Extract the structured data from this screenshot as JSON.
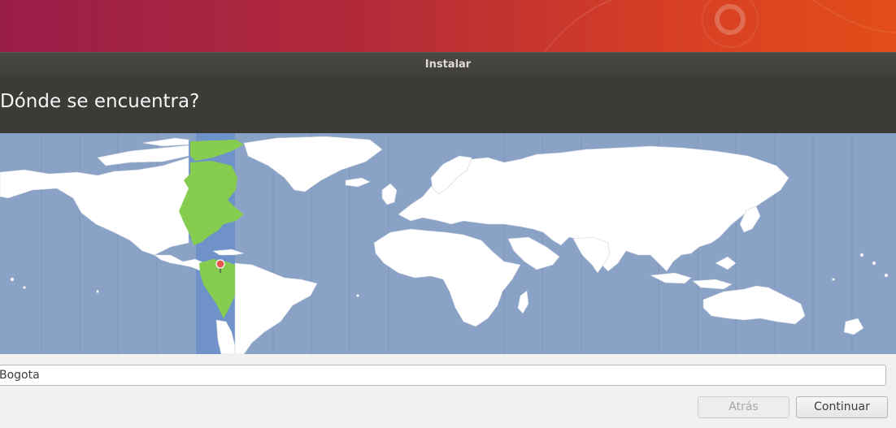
{
  "window": {
    "title": "Instalar"
  },
  "page": {
    "title": "Dónde se encuentra?"
  },
  "map": {
    "selected_timezone_color": "#6f92c8",
    "highlight_land_color": "#86cc4f",
    "marker_color": "#e8584b",
    "ocean_color": "#8ba2c7"
  },
  "location": {
    "value": "Bogota"
  },
  "buttons": {
    "back": "Atrás",
    "continue": "Continuar"
  },
  "colors": {
    "header_bg": "#3c3b37",
    "titlebar_bg": "#403f3b",
    "window_bg": "#f2f1f0"
  }
}
